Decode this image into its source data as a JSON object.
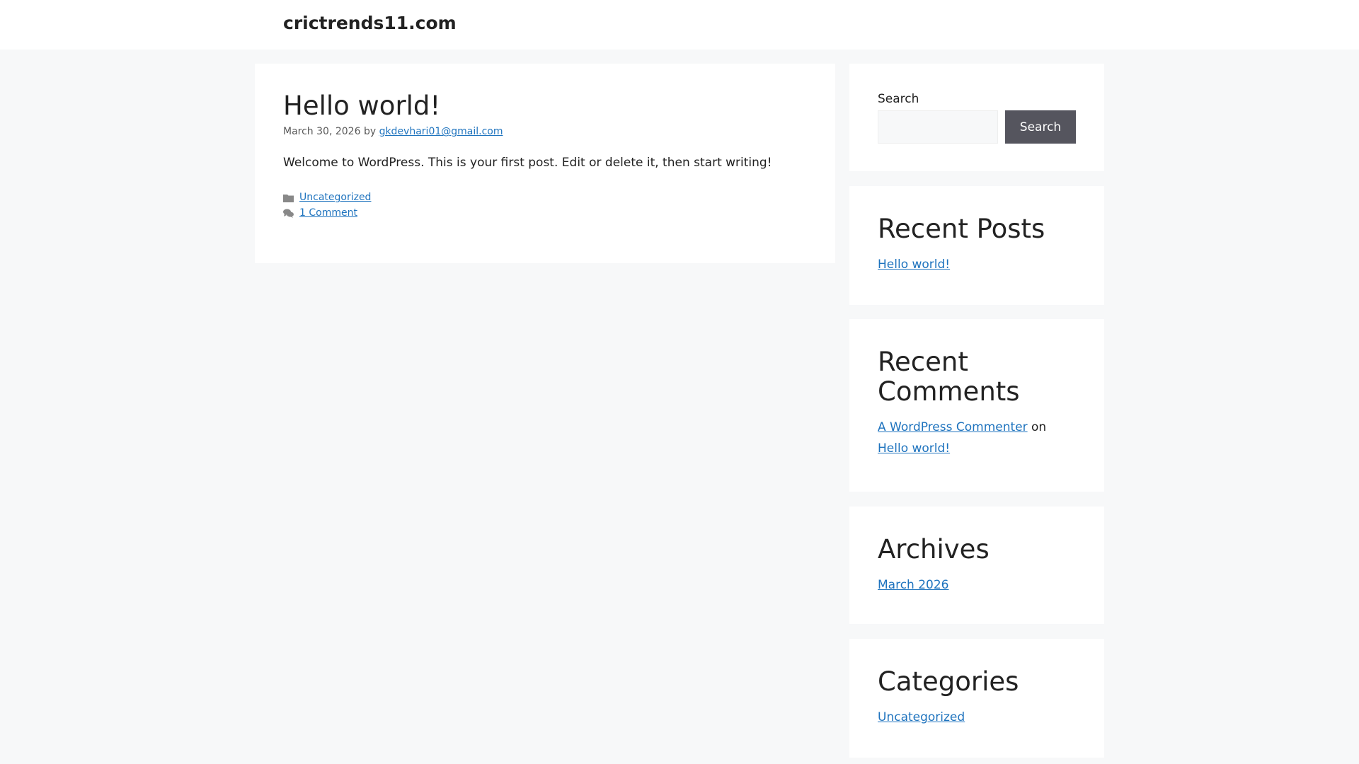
{
  "header": {
    "site_title": "crictrends11.com"
  },
  "post": {
    "title": "Hello world!",
    "date": "March 30, 2026",
    "by": "by",
    "author": "gkdevhari01@gmail.com",
    "content": "Welcome to WordPress. This is your first post. Edit or delete it, then start writing!",
    "category": "Uncategorized",
    "comments": "1 Comment"
  },
  "sidebar": {
    "search": {
      "label": "Search",
      "placeholder": "",
      "button": "Search"
    },
    "recent_posts": {
      "title": "Recent Posts",
      "items": [
        "Hello world!"
      ]
    },
    "recent_comments": {
      "title": "Recent Comments",
      "author": "A WordPress Commenter",
      "on": "on",
      "post": "Hello world!"
    },
    "archives": {
      "title": "Archives",
      "items": [
        "March 2026"
      ]
    },
    "categories": {
      "title": "Categories",
      "items": [
        "Uncategorized"
      ]
    }
  }
}
